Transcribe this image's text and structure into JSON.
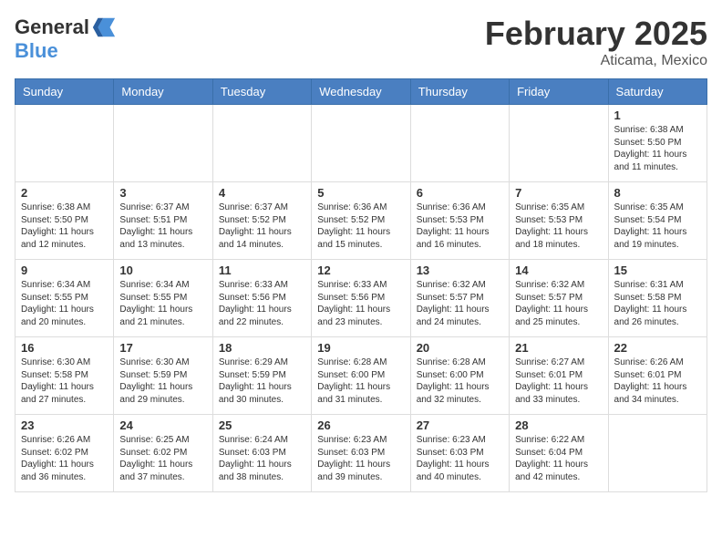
{
  "header": {
    "logo_general": "General",
    "logo_blue": "Blue",
    "month_title": "February 2025",
    "location": "Aticama, Mexico"
  },
  "weekdays": [
    "Sunday",
    "Monday",
    "Tuesday",
    "Wednesday",
    "Thursday",
    "Friday",
    "Saturday"
  ],
  "weeks": [
    [
      {
        "day": "",
        "info": ""
      },
      {
        "day": "",
        "info": ""
      },
      {
        "day": "",
        "info": ""
      },
      {
        "day": "",
        "info": ""
      },
      {
        "day": "",
        "info": ""
      },
      {
        "day": "",
        "info": ""
      },
      {
        "day": "1",
        "info": "Sunrise: 6:38 AM\nSunset: 5:50 PM\nDaylight: 11 hours\nand 11 minutes."
      }
    ],
    [
      {
        "day": "2",
        "info": "Sunrise: 6:38 AM\nSunset: 5:50 PM\nDaylight: 11 hours\nand 12 minutes."
      },
      {
        "day": "3",
        "info": "Sunrise: 6:37 AM\nSunset: 5:51 PM\nDaylight: 11 hours\nand 13 minutes."
      },
      {
        "day": "4",
        "info": "Sunrise: 6:37 AM\nSunset: 5:52 PM\nDaylight: 11 hours\nand 14 minutes."
      },
      {
        "day": "5",
        "info": "Sunrise: 6:36 AM\nSunset: 5:52 PM\nDaylight: 11 hours\nand 15 minutes."
      },
      {
        "day": "6",
        "info": "Sunrise: 6:36 AM\nSunset: 5:53 PM\nDaylight: 11 hours\nand 16 minutes."
      },
      {
        "day": "7",
        "info": "Sunrise: 6:35 AM\nSunset: 5:53 PM\nDaylight: 11 hours\nand 18 minutes."
      },
      {
        "day": "8",
        "info": "Sunrise: 6:35 AM\nSunset: 5:54 PM\nDaylight: 11 hours\nand 19 minutes."
      }
    ],
    [
      {
        "day": "9",
        "info": "Sunrise: 6:34 AM\nSunset: 5:55 PM\nDaylight: 11 hours\nand 20 minutes."
      },
      {
        "day": "10",
        "info": "Sunrise: 6:34 AM\nSunset: 5:55 PM\nDaylight: 11 hours\nand 21 minutes."
      },
      {
        "day": "11",
        "info": "Sunrise: 6:33 AM\nSunset: 5:56 PM\nDaylight: 11 hours\nand 22 minutes."
      },
      {
        "day": "12",
        "info": "Sunrise: 6:33 AM\nSunset: 5:56 PM\nDaylight: 11 hours\nand 23 minutes."
      },
      {
        "day": "13",
        "info": "Sunrise: 6:32 AM\nSunset: 5:57 PM\nDaylight: 11 hours\nand 24 minutes."
      },
      {
        "day": "14",
        "info": "Sunrise: 6:32 AM\nSunset: 5:57 PM\nDaylight: 11 hours\nand 25 minutes."
      },
      {
        "day": "15",
        "info": "Sunrise: 6:31 AM\nSunset: 5:58 PM\nDaylight: 11 hours\nand 26 minutes."
      }
    ],
    [
      {
        "day": "16",
        "info": "Sunrise: 6:30 AM\nSunset: 5:58 PM\nDaylight: 11 hours\nand 27 minutes."
      },
      {
        "day": "17",
        "info": "Sunrise: 6:30 AM\nSunset: 5:59 PM\nDaylight: 11 hours\nand 29 minutes."
      },
      {
        "day": "18",
        "info": "Sunrise: 6:29 AM\nSunset: 5:59 PM\nDaylight: 11 hours\nand 30 minutes."
      },
      {
        "day": "19",
        "info": "Sunrise: 6:28 AM\nSunset: 6:00 PM\nDaylight: 11 hours\nand 31 minutes."
      },
      {
        "day": "20",
        "info": "Sunrise: 6:28 AM\nSunset: 6:00 PM\nDaylight: 11 hours\nand 32 minutes."
      },
      {
        "day": "21",
        "info": "Sunrise: 6:27 AM\nSunset: 6:01 PM\nDaylight: 11 hours\nand 33 minutes."
      },
      {
        "day": "22",
        "info": "Sunrise: 6:26 AM\nSunset: 6:01 PM\nDaylight: 11 hours\nand 34 minutes."
      }
    ],
    [
      {
        "day": "23",
        "info": "Sunrise: 6:26 AM\nSunset: 6:02 PM\nDaylight: 11 hours\nand 36 minutes."
      },
      {
        "day": "24",
        "info": "Sunrise: 6:25 AM\nSunset: 6:02 PM\nDaylight: 11 hours\nand 37 minutes."
      },
      {
        "day": "25",
        "info": "Sunrise: 6:24 AM\nSunset: 6:03 PM\nDaylight: 11 hours\nand 38 minutes."
      },
      {
        "day": "26",
        "info": "Sunrise: 6:23 AM\nSunset: 6:03 PM\nDaylight: 11 hours\nand 39 minutes."
      },
      {
        "day": "27",
        "info": "Sunrise: 6:23 AM\nSunset: 6:03 PM\nDaylight: 11 hours\nand 40 minutes."
      },
      {
        "day": "28",
        "info": "Sunrise: 6:22 AM\nSunset: 6:04 PM\nDaylight: 11 hours\nand 42 minutes."
      },
      {
        "day": "",
        "info": ""
      }
    ]
  ]
}
